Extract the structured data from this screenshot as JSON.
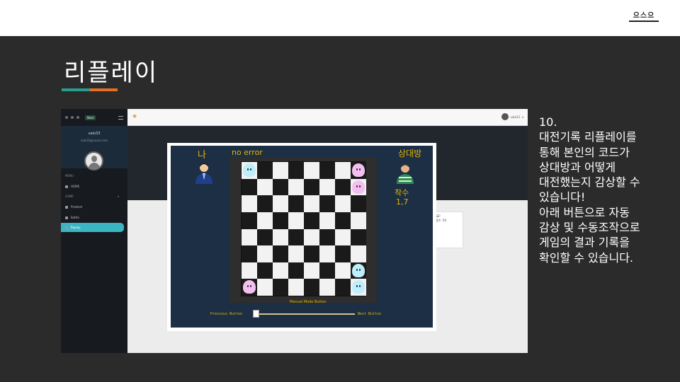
{
  "slide": {
    "title": "리플레이",
    "accent_colors": [
      "#2a9d8f",
      "#e76f24"
    ],
    "brand_logo_text": "으스으"
  },
  "app": {
    "sidebar": {
      "next_badge": "Next",
      "username": "valo33",
      "email": "valo33@naver.com",
      "section_menu": "MENU",
      "section_game": "GAME",
      "items": [
        {
          "label": "HOME",
          "icon": "home-icon"
        },
        {
          "label": "Problem",
          "icon": "puzzle-icon"
        },
        {
          "label": "Battle",
          "icon": "sword-icon"
        },
        {
          "label": "Replay",
          "icon": "replay-icon",
          "active": true
        }
      ]
    },
    "topbar": {
      "user": "valo33"
    },
    "background_card": {
      "line1": "LOSE!",
      "line2": "한 점수: 50"
    }
  },
  "replay": {
    "me_label": "나",
    "status": "no error",
    "opponent_label": "상대방",
    "moves_label": "착수",
    "move_value": "1,7",
    "manual_label": "Manual Mode Button",
    "prev_label": "Previous Button",
    "next_label": "Next Button",
    "slider_position": 0.0,
    "board": {
      "rows": 8,
      "cols": 8,
      "pieces": [
        {
          "row": 0,
          "col": 0,
          "color": "blue"
        },
        {
          "row": 0,
          "col": 7,
          "color": "pink"
        },
        {
          "row": 1,
          "col": 7,
          "color": "pink"
        },
        {
          "row": 6,
          "col": 7,
          "color": "blue"
        },
        {
          "row": 7,
          "col": 0,
          "color": "pink"
        },
        {
          "row": 7,
          "col": 7,
          "color": "blue"
        }
      ]
    }
  },
  "description": {
    "lines": [
      "10.",
      "대전기록 리플레이를",
      "통해 본인의 코드가",
      "상대방과 어떻게",
      "대전했는지 감상할 수",
      "있습니다!",
      "아래 버튼으로 자동",
      "감상 및 수동조작으로",
      "게임의 결과 기록을",
      "확인할 수 있습니다."
    ]
  }
}
